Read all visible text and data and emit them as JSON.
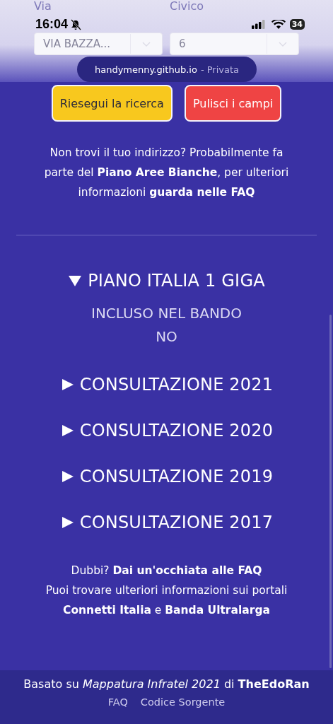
{
  "status_bar": {
    "time": "16:04",
    "battery": "34"
  },
  "url_bar": {
    "domain": "handymenny.github.io",
    "mode": "- Privata"
  },
  "form": {
    "fields": [
      {
        "label": "Via",
        "value": "VIA BAZZA..."
      },
      {
        "label": "Civico",
        "value": "6"
      }
    ]
  },
  "buttons": [
    {
      "label": "Riesegui la ricerca",
      "kind": "search"
    },
    {
      "label": "Pulisci i campi",
      "kind": "clear"
    }
  ],
  "notice": "Non trovi il tuo indirizzo? Probabilmente fa parte del **Piano Aree Bianche**, per ulteriori informazioni **guarda nelle FAQ**",
  "sections": [
    {
      "title": "PIANO ITALIA 1 GIGA",
      "expanded": true,
      "details": [
        "INCLUSO NEL BANDO",
        "NO"
      ]
    },
    {
      "title": "CONSULTAZIONE 2021",
      "expanded": false
    },
    {
      "title": "CONSULTAZIONE 2020",
      "expanded": false
    },
    {
      "title": "CONSULTAZIONE 2019",
      "expanded": false
    },
    {
      "title": "CONSULTAZIONE 2017",
      "expanded": false
    }
  ],
  "help": [
    "Dubbi? **Dai un'occhiata alle FAQ**",
    "Puoi trovare ulteriori informazioni sui portali",
    "**Connetti Italia** e **Banda Ultralarga**"
  ],
  "footer": {
    "credit": "Basato su *Mappatura Infratel 2021* di **TheEdoRan**",
    "links": [
      "FAQ",
      "Codice Sorgente"
    ]
  }
}
